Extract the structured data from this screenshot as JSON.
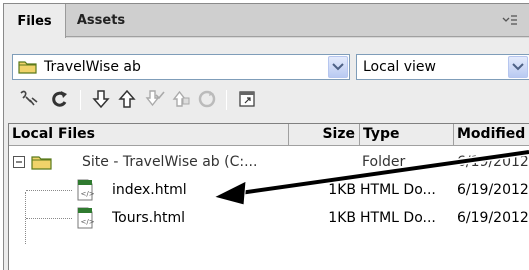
{
  "tabs": [
    {
      "label": "Files",
      "active": true
    },
    {
      "label": "Assets",
      "active": false
    }
  ],
  "site_select": {
    "value": "TravelWise ab"
  },
  "view_select": {
    "value": "Local view"
  },
  "toolbar": {
    "icons": [
      "connect-icon",
      "refresh-icon",
      "get-files-icon",
      "put-files-icon",
      "check-out-icon",
      "check-in-icon",
      "synchronize-icon",
      "expand-icon"
    ]
  },
  "table": {
    "columns": [
      "Local Files",
      "Size",
      "Type",
      "Modified"
    ],
    "rows": [
      {
        "name": "Site - TravelWise ab (C:...",
        "size": "",
        "type": "Folder",
        "modified": "6/19/2012",
        "kind": "folder"
      },
      {
        "name": "index.html",
        "size": "1KB",
        "type": "HTML Do...",
        "modified": "6/19/2012",
        "kind": "file"
      },
      {
        "name": "Tours.html",
        "size": "1KB",
        "type": "HTML Do...",
        "modified": "6/19/2012",
        "kind": "file"
      }
    ]
  },
  "colors": {
    "panel_bg": "#ececec",
    "tab_bg": "#cfcfcf",
    "select_border": "#7f9db9",
    "folder": "#e8c84a",
    "arrow": "#000000"
  }
}
